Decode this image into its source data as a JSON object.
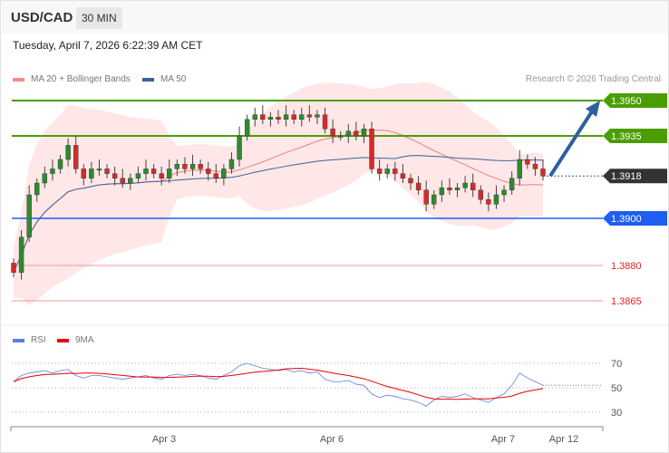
{
  "header": {
    "symbol": "USD/CAD",
    "timeframe": "30 MIN"
  },
  "timestamp": "Tuesday, April 7, 2026 6:22:39 AM CET",
  "copyright": "Research © 2026 Trading Central",
  "colors": {
    "up": "#2f8a2f",
    "down": "#d62a2a",
    "resistance": "#4c9e00",
    "support": "#1e5ef0",
    "ma20": "#f07f7f",
    "ma50": "#3a5f9f",
    "band": "#ffe3e3",
    "current": "#333333",
    "arrow": "#2e5f9f"
  },
  "chart_data": [
    {
      "type": "candlestick",
      "title": "USD/CAD 30 MIN",
      "legend": [
        "MA 20 + Bollinger Bands",
        "MA 50"
      ],
      "ylim": [
        1.3855,
        1.396
      ],
      "x_ticks": [
        "Apr 3",
        "Apr 6",
        "Apr 7",
        "Apr 12"
      ],
      "closes": [
        1.3877,
        1.3892,
        1.391,
        1.3915,
        1.3919,
        1.3921,
        1.3925,
        1.3931,
        1.3921,
        1.3917,
        1.3921,
        1.3921,
        1.3919,
        1.3917,
        1.3915,
        1.3917,
        1.3919,
        1.3921,
        1.3919,
        1.3917,
        1.3921,
        1.3923,
        1.3921,
        1.3923,
        1.3921,
        1.3919,
        1.3917,
        1.3921,
        1.3925,
        1.3935,
        1.3942,
        1.3944,
        1.3942,
        1.3943,
        1.3942,
        1.3944,
        1.3942,
        1.3944,
        1.3943,
        1.3944,
        1.3938,
        1.3935,
        1.3935,
        1.3937,
        1.3935,
        1.3938,
        1.3921,
        1.3919,
        1.3921,
        1.3919,
        1.3917,
        1.3915,
        1.3912,
        1.3906,
        1.391,
        1.3913,
        1.3912,
        1.3913,
        1.3915,
        1.3912,
        1.3908,
        1.3906,
        1.391,
        1.3912,
        1.3917,
        1.3925,
        1.3923,
        1.3921,
        1.3918
      ],
      "levels": [
        {
          "label": "1.3950",
          "value": 1.395,
          "kind": "resistance"
        },
        {
          "label": "1.3935",
          "value": 1.3935,
          "kind": "resistance"
        },
        {
          "label": "1.3918",
          "value": 1.3918,
          "kind": "current"
        },
        {
          "label": "1.3900",
          "value": 1.39,
          "kind": "support"
        },
        {
          "label": "1.3880",
          "value": 1.388,
          "kind": "minor"
        },
        {
          "label": "1.3865",
          "value": 1.3865,
          "kind": "minor"
        }
      ],
      "forecast": {
        "from": 1.3918,
        "to": 1.395,
        "direction": "up"
      }
    },
    {
      "type": "line",
      "title": "RSI",
      "legend": [
        "RSI",
        "9MA"
      ],
      "ylim": [
        20,
        80
      ],
      "y_ticks": [
        "70",
        "50",
        "30"
      ],
      "rsi": [
        55,
        60,
        62,
        63,
        64,
        62,
        64,
        65,
        60,
        58,
        60,
        60,
        59,
        58,
        57,
        58,
        59,
        60,
        58,
        57,
        60,
        61,
        60,
        61,
        60,
        58,
        57,
        60,
        63,
        68,
        70,
        68,
        66,
        65,
        64,
        65,
        63,
        64,
        62,
        63,
        57,
        55,
        55,
        56,
        53,
        52,
        45,
        42,
        44,
        43,
        41,
        40,
        38,
        35,
        40,
        43,
        42,
        43,
        45,
        42,
        40,
        38,
        42,
        45,
        52,
        62,
        58,
        55,
        52
      ]
    }
  ]
}
